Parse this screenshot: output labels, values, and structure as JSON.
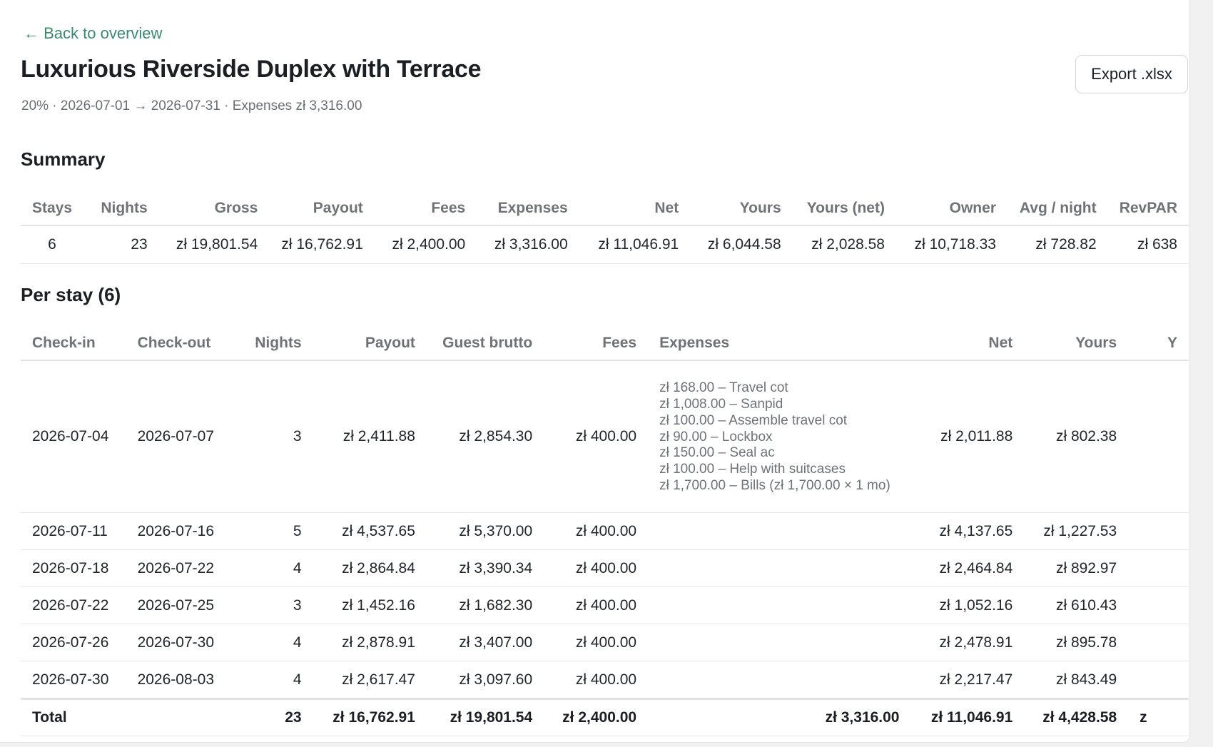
{
  "nav": {
    "back_label": "← Back to overview"
  },
  "header": {
    "title": "Luxurious Riverside Duplex with Terrace",
    "subtitle": "20% · 2026-07-01 → 2026-07-31 · Expenses zł 3,316.00",
    "export_label": "Export .xlsx"
  },
  "summary": {
    "title": "Summary",
    "headers": [
      "Stays",
      "Nights",
      "Gross",
      "Payout",
      "Fees",
      "Expenses",
      "Net",
      "Yours",
      "Yours (net)",
      "Owner",
      "Avg / night",
      "RevPAR"
    ],
    "values": [
      "6",
      "23",
      "zł 19,801.54",
      "zł 16,762.91",
      "zł 2,400.00",
      "zł 3,316.00",
      "zł 11,046.91",
      "zł 6,044.58",
      "zł 2,028.58",
      "zł 10,718.33",
      "zł 728.82",
      "zł 638"
    ]
  },
  "per_stay": {
    "title": "Per stay (6)",
    "headers": [
      "Check-in",
      "Check-out",
      "Nights",
      "Payout",
      "Guest brutto",
      "Fees",
      "Expenses",
      "Net",
      "Yours",
      "Y"
    ],
    "rows": [
      {
        "checkin": "2026-07-04",
        "checkout": "2026-07-07",
        "nights": "3",
        "payout": "zł 2,411.88",
        "guest": "zł 2,854.30",
        "fees": "zł 400.00",
        "expenses": [
          "zł 168.00 – Travel cot",
          "zł 1,008.00 – Sanpid",
          "zł 100.00 – Assemble travel cot",
          "zł 90.00 – Lockbox",
          "zł 150.00 – Seal ac",
          "zł 100.00 – Help with suitcases",
          "zł 1,700.00 – Bills (zł 1,700.00 × 1 mo)"
        ],
        "net": "zł 2,011.88",
        "yours": "zł 802.38"
      },
      {
        "checkin": "2026-07-11",
        "checkout": "2026-07-16",
        "nights": "5",
        "payout": "zł 4,537.65",
        "guest": "zł 5,370.00",
        "fees": "zł 400.00",
        "expenses": [],
        "net": "zł 4,137.65",
        "yours": "zł 1,227.53"
      },
      {
        "checkin": "2026-07-18",
        "checkout": "2026-07-22",
        "nights": "4",
        "payout": "zł 2,864.84",
        "guest": "zł 3,390.34",
        "fees": "zł 400.00",
        "expenses": [],
        "net": "zł 2,464.84",
        "yours": "zł 892.97"
      },
      {
        "checkin": "2026-07-22",
        "checkout": "2026-07-25",
        "nights": "3",
        "payout": "zł 1,452.16",
        "guest": "zł 1,682.30",
        "fees": "zł 400.00",
        "expenses": [],
        "net": "zł 1,052.16",
        "yours": "zł 610.43"
      },
      {
        "checkin": "2026-07-26",
        "checkout": "2026-07-30",
        "nights": "4",
        "payout": "zł 2,878.91",
        "guest": "zł 3,407.00",
        "fees": "zł 400.00",
        "expenses": [],
        "net": "zł 2,478.91",
        "yours": "zł 895.78"
      },
      {
        "checkin": "2026-07-30",
        "checkout": "2026-08-03",
        "nights": "4",
        "payout": "zł 2,617.47",
        "guest": "zł 3,097.60",
        "fees": "zł 400.00",
        "expenses": [],
        "net": "zł 2,217.47",
        "yours": "zł 843.49"
      }
    ],
    "total": {
      "label": "Total",
      "nights": "23",
      "payout": "zł 16,762.91",
      "guest": "zł 19,801.54",
      "fees": "zł 2,400.00",
      "expenses": "zł 3,316.00",
      "net": "zł 11,046.91",
      "yours": "zł 4,428.58",
      "extra": "z"
    }
  },
  "colors": {
    "accent": "#3a8a6c",
    "muted": "#6f7378",
    "border": "#e3e3e3"
  }
}
